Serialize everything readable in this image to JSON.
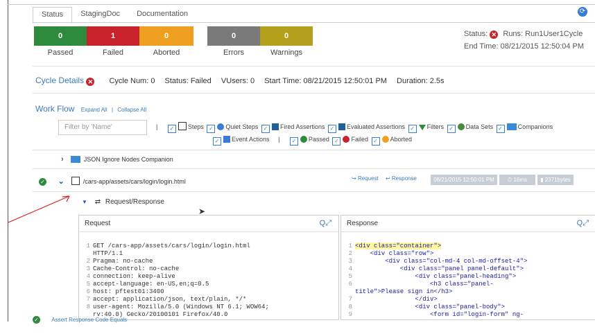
{
  "tabs": [
    "Status",
    "StagingDoc",
    "Documentation"
  ],
  "status_boxes": [
    {
      "value": "0",
      "label": "Passed",
      "color": "#2e8b3e"
    },
    {
      "value": "1",
      "label": "Failed",
      "color": "#c8232a"
    },
    {
      "value": "0",
      "label": "Aborted",
      "color": "#f0a020"
    },
    {
      "value": "0",
      "label": "Errors",
      "color": "#7a7a7a"
    },
    {
      "value": "0",
      "label": "Warnings",
      "color": "#b5a01e"
    }
  ],
  "status_summary": {
    "status_label": "Status:",
    "runs": "Runs: Run1User1Cycle",
    "end_time": "End Time: 08/21/2015 12:50:04 PM"
  },
  "cycle_details": {
    "title": "Cycle Details",
    "cycle_num": "Cycle Num: 0",
    "status": "Status: Failed",
    "vusers": "VUsers: 0",
    "start_time": "Start Time: 08/21/2015 12:50:01 PM",
    "duration": "Duration: 2.5s"
  },
  "workflow": {
    "title": "Work Flow",
    "expand_all": "Expand All",
    "collapse_all": "Collapse All",
    "filter_placeholder": "Filter by 'Name'"
  },
  "filters_row1": [
    "Steps",
    "Quiet Steps",
    "Fired Assertions",
    "Evaluated Assertions",
    "Filters",
    "Data Sets",
    "Companions"
  ],
  "filters_row2": [
    "Event Actions",
    "Passed",
    "Failed",
    "Aborted"
  ],
  "steps": {
    "companion": "JSON Ignore Nodes Companion",
    "request_step": "/cars-app/assets/cars/login/login.html",
    "request_link": "Request",
    "response_link": "Response",
    "timestamp": "08/21/2015 12:50:01 PM",
    "elapsed": "16ms",
    "size": "2371bytes",
    "reqresp": "Request/Response",
    "next_step": "Assert Response Code Equals"
  },
  "request_panel": {
    "title": "Request",
    "lines": [
      {
        "n": "1",
        "t": "GET /cars-app/assets/cars/login/login.html"
      },
      {
        "n": "",
        "t": "HTTP/1.1"
      },
      {
        "n": "2",
        "t": "Pragma: no-cache"
      },
      {
        "n": "3",
        "t": "Cache-Control: no-cache"
      },
      {
        "n": "4",
        "t": "connection: keep-alive"
      },
      {
        "n": "5",
        "t": "accept-language: en-US,en;q=0.5"
      },
      {
        "n": "6",
        "t": "host: pftest01:3400"
      },
      {
        "n": "7",
        "t": "accept: application/json, text/plain, */*"
      },
      {
        "n": "8",
        "t": "user-agent: Mozilla/5.0 (Windows NT 6.1; WOW64;"
      },
      {
        "n": "",
        "t": "rv:40.0) Gecko/20100101 Firefox/40.0"
      }
    ]
  },
  "response_panel": {
    "title": "Response",
    "lines": [
      {
        "n": "1",
        "t": "<div class=\"container\">"
      },
      {
        "n": "2",
        "t": "    <div class=\"row\">"
      },
      {
        "n": "3",
        "t": "        <div class=\"col-md-4 col-md-offset-4\">"
      },
      {
        "n": "4",
        "t": "            <div class=\"panel panel-default\">"
      },
      {
        "n": "5",
        "t": "                <div class=\"panel-heading\">"
      },
      {
        "n": "6",
        "t": "                    <h3 class=\"panel-"
      },
      {
        "n": "",
        "t": "title\">Please sign in</h3>"
      },
      {
        "n": "7",
        "t": "                </div>"
      },
      {
        "n": "8",
        "t": "                <div class=\"panel-body\">"
      },
      {
        "n": "9",
        "t": "                    <form id=\"login-form\" ng-"
      }
    ]
  }
}
